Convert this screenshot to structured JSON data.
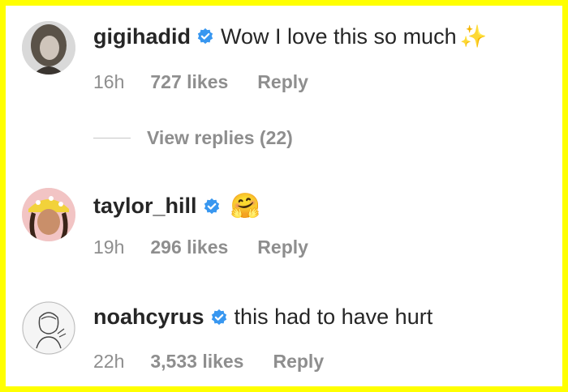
{
  "comments": [
    {
      "username": "gigihadid",
      "verified": true,
      "text": "Wow I love this so much",
      "emoji": "✨",
      "time": "16h",
      "likes": "727 likes",
      "reply": "Reply",
      "avatar_icon": "avatar-photo-icon"
    },
    {
      "username": "taylor_hill",
      "verified": true,
      "text": "",
      "emoji": "🤗",
      "time": "19h",
      "likes": "296 likes",
      "reply": "Reply",
      "avatar_icon": "avatar-photo-icon"
    },
    {
      "username": "noahcyrus",
      "verified": true,
      "text": "this had to have hurt",
      "emoji": "",
      "time": "22h",
      "likes": "3,533 likes",
      "reply": "Reply",
      "avatar_icon": "avatar-sketch-icon"
    }
  ],
  "view_replies": "View replies (22)",
  "colors": {
    "border": "#ffff00",
    "verified": "#3897f0",
    "username": "#262626",
    "meta": "#8e8e8e"
  }
}
